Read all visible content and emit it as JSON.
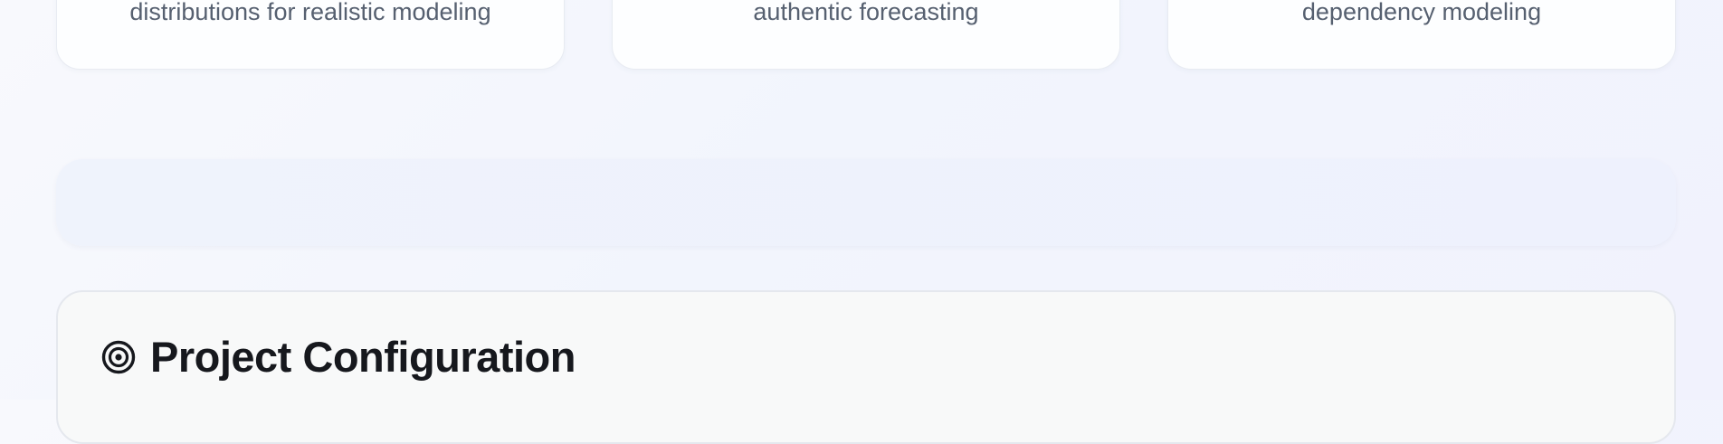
{
  "feature_cards": [
    {
      "text": "distributions for realistic modeling"
    },
    {
      "text": "authentic forecasting"
    },
    {
      "text": "dependency modeling"
    }
  ],
  "config_section": {
    "icon": "target-icon",
    "title": "Project Configuration"
  },
  "colors": {
    "page_background": "#f2f5fd",
    "card_background": "#fdfeff",
    "card_text": "#566070",
    "panel_background": "#f8f9f9",
    "title_text": "#16181d"
  }
}
